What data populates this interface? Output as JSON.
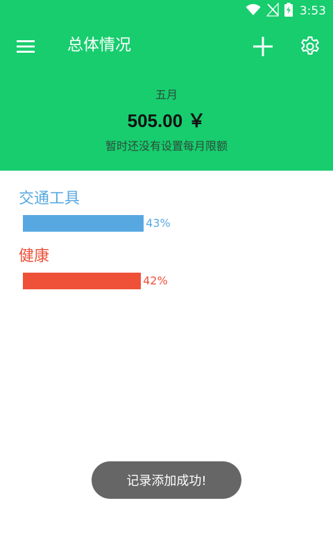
{
  "status_bar": {
    "time": "3:53",
    "icons": [
      "wifi-icon",
      "no-signal-icon",
      "battery-charging-icon"
    ]
  },
  "app_bar": {
    "title": "总体情况",
    "background_color": "#17cd6e",
    "icons": {
      "menu": "menu-icon",
      "add": "add-icon",
      "settings": "gear-icon"
    }
  },
  "summary": {
    "month": "五月",
    "amount": "505.00 ￥",
    "budget_note": "暂时还没有设置每月限额"
  },
  "categories": [
    {
      "label": "交通工具",
      "percent": 43,
      "percent_text": "43%",
      "color": "#57a8e1"
    },
    {
      "label": "健康",
      "percent": 42,
      "percent_text": "42%",
      "color": "#ee5138"
    }
  ],
  "toast": {
    "message": "记录添加成功!"
  }
}
